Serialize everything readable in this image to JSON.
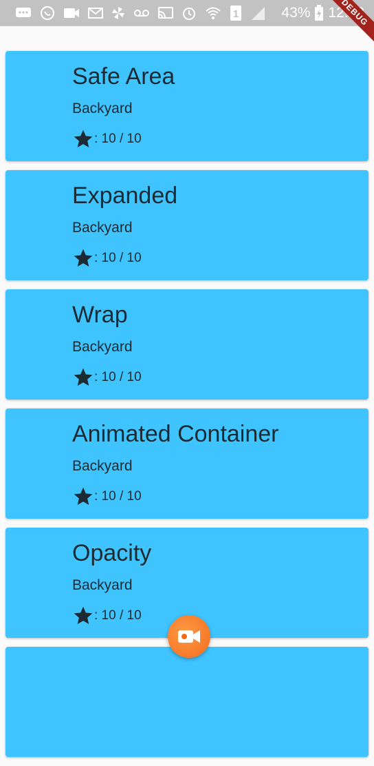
{
  "status_bar": {
    "battery_percent": "43%",
    "time": "12:58",
    "sim_badge": "1",
    "icons": [
      "messaging-icon",
      "whatsapp-icon",
      "video-icon",
      "mail-icon",
      "pinwheel-icon",
      "voicemail-icon",
      "cast-icon",
      "alarm-icon",
      "wifi-icon",
      "sim-icon",
      "signal-icon",
      "battery-charging-icon"
    ]
  },
  "debug_banner": "DEBUG",
  "cards": [
    {
      "title": "Safe Area",
      "subtitle": "Backyard",
      "rating": ": 10 / 10"
    },
    {
      "title": "Expanded",
      "subtitle": "Backyard",
      "rating": ": 10 / 10"
    },
    {
      "title": "Wrap",
      "subtitle": "Backyard",
      "rating": ": 10 / 10"
    },
    {
      "title": "Animated Container",
      "subtitle": "Backyard",
      "rating": ": 10 / 10"
    },
    {
      "title": "Opacity",
      "subtitle": "Backyard",
      "rating": ": 10 / 10"
    }
  ],
  "fab": {
    "icon": "video-camera-icon"
  },
  "colors": {
    "card": "#40c4ff",
    "text": "#1c2a33",
    "fab": "#f26b1d",
    "status_bar": "#c2c2c2",
    "debug": "#a2231d"
  }
}
